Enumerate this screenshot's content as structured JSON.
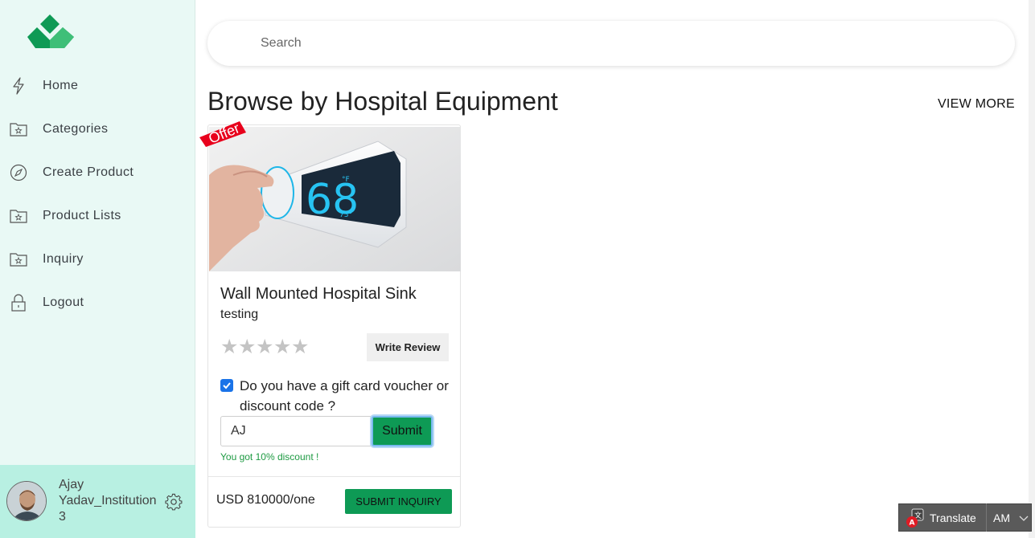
{
  "sidebar": {
    "items": [
      {
        "label": "Home",
        "icon": "lightning-icon"
      },
      {
        "label": "Categories",
        "icon": "folder-star-icon"
      },
      {
        "label": "Create Product",
        "icon": "compass-icon"
      },
      {
        "label": "Product Lists",
        "icon": "folder-star-icon"
      },
      {
        "label": "Inquiry",
        "icon": "folder-star-icon"
      },
      {
        "label": "Logout",
        "icon": "lock-icon"
      }
    ],
    "user": {
      "name": "Ajay Yadav_Institution 3"
    }
  },
  "search": {
    "placeholder": "Search"
  },
  "section": {
    "title": "Browse by Hospital Equipment",
    "view_more": "VIEW MORE"
  },
  "product": {
    "badge": "Offer",
    "name": "Wall Mounted Hospital Sink",
    "description": "testing",
    "rating": 0,
    "max_rating": 5,
    "write_review": "Write Review",
    "gift_question": "Do you have a gift card voucher or discount code ?",
    "gift_checked": true,
    "code_value": "AJ",
    "submit": "Submit",
    "discount_message": "You got 10% discount !",
    "price": "USD 810000/one",
    "inquiry": "SUBMIT INQUIRY",
    "image_display": {
      "temp": "68",
      "unit": "°F",
      "small": "73°"
    }
  },
  "translate": {
    "label": "Translate",
    "lang": "AM"
  },
  "colors": {
    "accent": "#0e9a55",
    "sidebar_bg": "#e9f9f5",
    "user_bg": "#b8f0e2",
    "offer_red": "#e8001c"
  }
}
